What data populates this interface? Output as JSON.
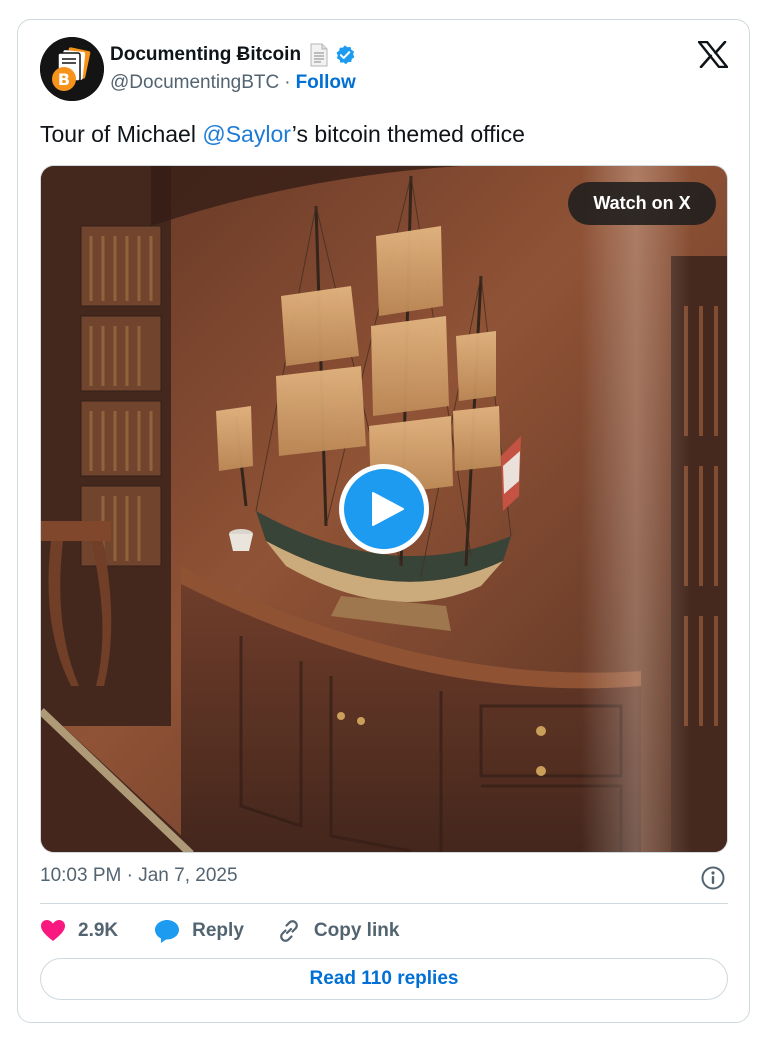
{
  "author": {
    "display_name": "Documenting Ƀitcoin",
    "handle": "@DocumentingBTC",
    "separator": "·",
    "follow_label": "Follow",
    "verified": true,
    "avatar_icon": "bitcoin-document-avatar-icon"
  },
  "tweet": {
    "text_before": "Tour of Michael ",
    "mention": "@Saylor",
    "text_after": "’s bitcoin themed office"
  },
  "media": {
    "watch_label": "Watch on X",
    "play_icon": "play-icon",
    "description_icon": "video-thumbnail"
  },
  "meta": {
    "timestamp": "10:03 PM · Jan 7, 2025"
  },
  "actions": {
    "like_count": "2.9K",
    "reply_label": "Reply",
    "copy_label": "Copy link"
  },
  "footer": {
    "read_replies_label": "Read 110 replies"
  },
  "colors": {
    "accent": "#1d9bf0",
    "link": "#006fd6",
    "like": "#f91880",
    "muted": "#536471",
    "border": "#cfd9de"
  }
}
